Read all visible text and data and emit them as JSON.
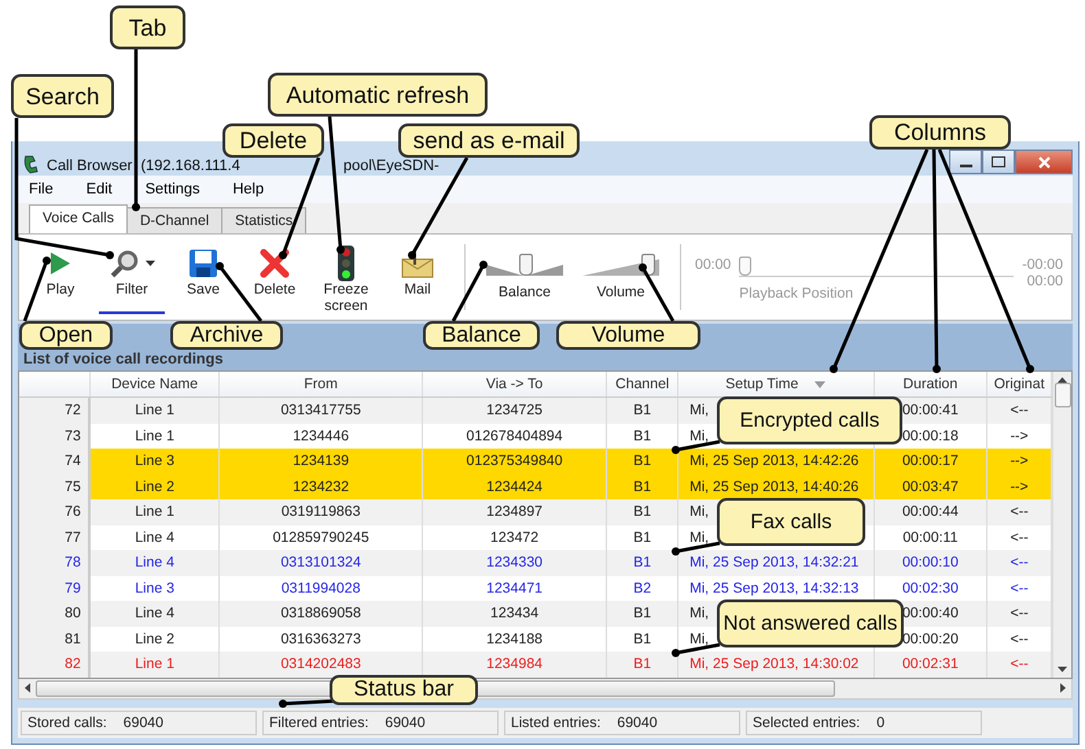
{
  "window": {
    "title_parts": [
      "Call Browser  (192.168.111.4",
      "pool\\EyeSDN-"
    ]
  },
  "menu": [
    "File",
    "Edit",
    "Settings",
    "Help"
  ],
  "tabs": [
    {
      "label": "Voice Calls",
      "selected": true
    },
    {
      "label": "D-Channel",
      "selected": false
    },
    {
      "label": "Statistics",
      "selected": false
    }
  ],
  "toolbar": {
    "buttons": [
      {
        "kind": "play",
        "label": "Play",
        "active": false
      },
      {
        "kind": "filter",
        "label": "Filter",
        "active": true
      },
      {
        "kind": "save",
        "label": "Save",
        "active": false
      },
      {
        "kind": "delete",
        "label": "Delete",
        "active": false
      },
      {
        "kind": "freeze",
        "label": "Freeze screen",
        "active": false
      },
      {
        "kind": "mail",
        "label": "Mail",
        "active": false
      }
    ],
    "sliders": [
      {
        "kind": "balance",
        "label": "Balance",
        "level": 0.5
      },
      {
        "kind": "volume",
        "label": "Volume",
        "level": 0.9
      }
    ],
    "playback": {
      "start": "00:00",
      "label": "Playback Position",
      "level": 0,
      "remaining": "-00:00",
      "total": "00:00"
    }
  },
  "list": {
    "title": "List of voice call recordings",
    "columns": [
      {
        "label": "Device Name",
        "sorted": false
      },
      {
        "label": "From",
        "sorted": false
      },
      {
        "label": "Via -> To",
        "sorted": false
      },
      {
        "label": "Channel",
        "sorted": false
      },
      {
        "label": "Setup Time",
        "sorted": true
      },
      {
        "label": "Duration",
        "sorted": false
      },
      {
        "label": "Originat",
        "sorted": false
      }
    ],
    "rows": [
      {
        "number": "72",
        "kind": "normal",
        "cells": [
          "Line 1",
          "0313417755",
          "1234725",
          "B1",
          "Mi,",
          "00:00:41",
          "<--"
        ]
      },
      {
        "number": "73",
        "kind": "normal",
        "cells": [
          "Line 1",
          "1234446",
          "012678404894",
          "B1",
          "Mi,",
          "00:00:18",
          "-->"
        ]
      },
      {
        "number": "74",
        "kind": "encrypted",
        "cells": [
          "Line 3",
          "1234139",
          "012375349840",
          "B1",
          "Mi, 25 Sep 2013, 14:42:26",
          "00:00:17",
          "-->"
        ]
      },
      {
        "number": "75",
        "kind": "encrypted",
        "cells": [
          "Line 2",
          "1234232",
          "1234424",
          "B1",
          "Mi, 25 Sep 2013, 14:40:26",
          "00:03:47",
          "-->"
        ]
      },
      {
        "number": "76",
        "kind": "normal",
        "cells": [
          "Line 1",
          "0319119863",
          "1234897",
          "B1",
          "Mi,",
          "00:00:44",
          "<--"
        ]
      },
      {
        "number": "77",
        "kind": "normal",
        "cells": [
          "Line 4",
          "012859790245",
          "123472",
          "B1",
          "Mi,",
          "00:00:11",
          "<--"
        ]
      },
      {
        "number": "78",
        "kind": "fax",
        "cells": [
          "Line 4",
          "0313101324",
          "1234330",
          "B1",
          "Mi, 25 Sep 2013, 14:32:21",
          "00:00:10",
          "<--"
        ]
      },
      {
        "number": "79",
        "kind": "fax",
        "cells": [
          "Line 3",
          "0311994028",
          "1234471",
          "B2",
          "Mi, 25 Sep 2013, 14:32:13",
          "00:02:30",
          "<--"
        ]
      },
      {
        "number": "80",
        "kind": "normal",
        "cells": [
          "Line 4",
          "0318869058",
          "123434",
          "B1",
          "Mi,",
          "00:00:40",
          "<--"
        ]
      },
      {
        "number": "81",
        "kind": "normal",
        "cells": [
          "Line 2",
          "0316363273",
          "1234188",
          "B1",
          "Mi,",
          "00:00:20",
          "<--"
        ]
      },
      {
        "number": "82",
        "kind": "unanswered",
        "cells": [
          "Line 1",
          "0314202483",
          "1234984",
          "B1",
          "Mi, 25 Sep 2013, 14:30:02",
          "00:02:31",
          "<--"
        ]
      }
    ]
  },
  "status_bar": [
    {
      "label": "Stored calls:",
      "value": "69040"
    },
    {
      "label": "Filtered entries:",
      "value": "69040"
    },
    {
      "label": "Listed entries:",
      "value": "69040"
    },
    {
      "label": "Selected entries:",
      "value": "0"
    }
  ],
  "annotations": [
    "Tab",
    "Search",
    "Automatic refresh",
    "Delete",
    "send as e-mail",
    "Columns",
    "Open",
    "Archive",
    "Balance",
    "Volume",
    "Encrypted calls",
    "Fax calls",
    "Not answered calls",
    "Status bar"
  ]
}
